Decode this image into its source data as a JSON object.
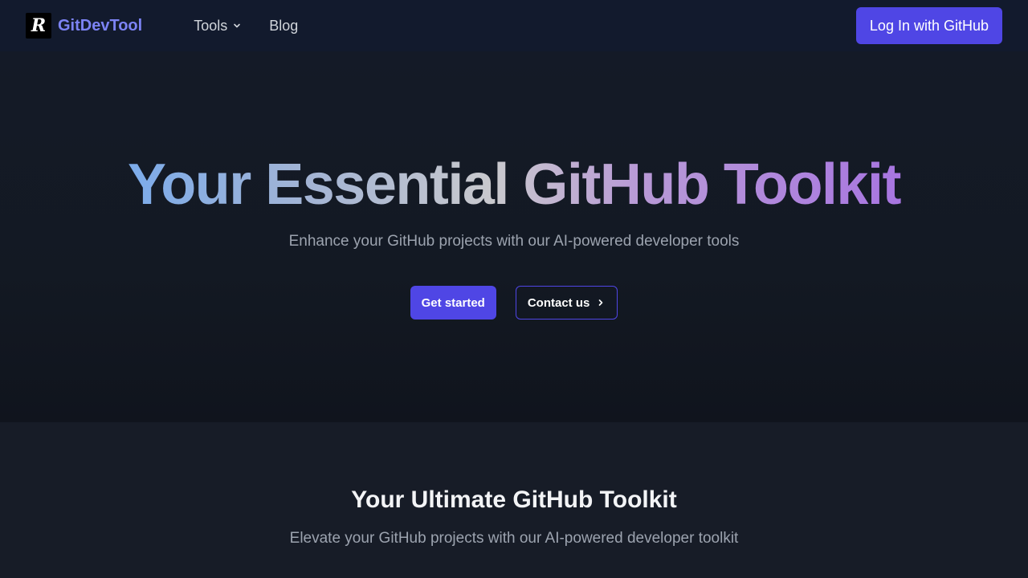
{
  "brand": {
    "logo_glyph": "R",
    "name": "GitDevTool"
  },
  "nav": {
    "items": [
      {
        "label": "Tools",
        "has_dropdown": true,
        "icon": "chevron-down-icon"
      },
      {
        "label": "Blog",
        "has_dropdown": false
      }
    ],
    "login_label": "Log In with GitHub"
  },
  "hero": {
    "title": "Your Essential GitHub Toolkit",
    "subtitle": "Enhance your GitHub projects with our AI-powered developer tools",
    "primary_cta": "Get started",
    "secondary_cta": "Contact us",
    "secondary_icon": "chevron-right-icon"
  },
  "section": {
    "title": "Your Ultimate GitHub Toolkit",
    "subtitle": "Elevate your GitHub projects with our AI-powered developer toolkit"
  },
  "colors": {
    "accent": "#4f46e5",
    "brand_text": "#7c83f4",
    "background": "#111827",
    "gradient_start": "#60a5fa",
    "gradient_end": "#a064e6"
  }
}
